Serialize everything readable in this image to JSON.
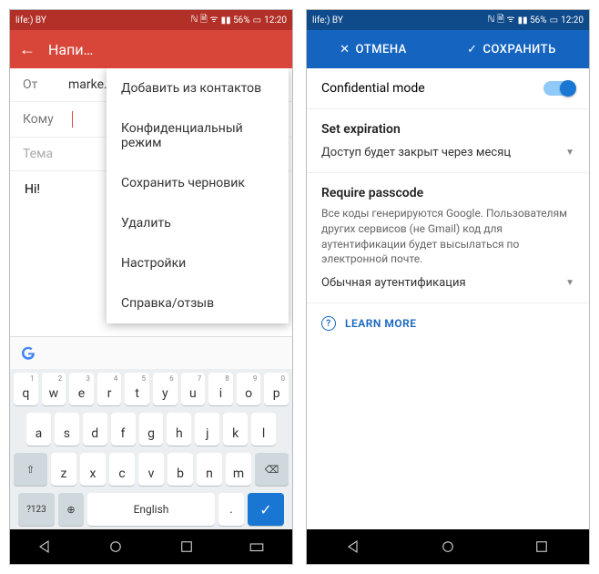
{
  "status": {
    "carrier": "life:) BY",
    "icons": "ℕ 🗎 ᯤ",
    "signal": "▮▮ 56%",
    "battery": "▭",
    "time": "12:20"
  },
  "left": {
    "title": "Напи…",
    "from_label": "От",
    "from_value": "marke…",
    "to_label": "Кому",
    "subject_label": "Тема",
    "body": "Hi!",
    "menu": [
      "Добавить из контактов",
      "Конфиденциальный режим",
      "Сохранить черновик",
      "Удалить",
      "Настройки",
      "Справка/отзыв"
    ],
    "keyboard": {
      "row1": [
        "q",
        "w",
        "e",
        "r",
        "t",
        "y",
        "u",
        "i",
        "o",
        "p"
      ],
      "sup1": [
        "1",
        "2",
        "3",
        "4",
        "5",
        "6",
        "7",
        "8",
        "9",
        "0"
      ],
      "row2": [
        "a",
        "s",
        "d",
        "f",
        "g",
        "h",
        "j",
        "k",
        "l"
      ],
      "row3": [
        "z",
        "x",
        "c",
        "v",
        "b",
        "n",
        "m"
      ],
      "sym": "?123",
      "emoji": "☺",
      "lang": "⊕",
      "space": "English",
      "period": ".",
      "enter": "✓"
    }
  },
  "right": {
    "cancel": "ОТМЕНА",
    "save": "СОХРАНИТЬ",
    "confidential_label": "Confidential mode",
    "expiration_title": "Set expiration",
    "expiration_value": "Доступ будет закрыт через месяц",
    "passcode_title": "Require passcode",
    "passcode_desc": "Все коды генерируются Google. Пользователям других сервисов (не Gmail) код для аутентификации будет высылаться по электронной почте.",
    "passcode_value": "Обычная аутентификация",
    "learn_more": "LEARN MORE"
  }
}
